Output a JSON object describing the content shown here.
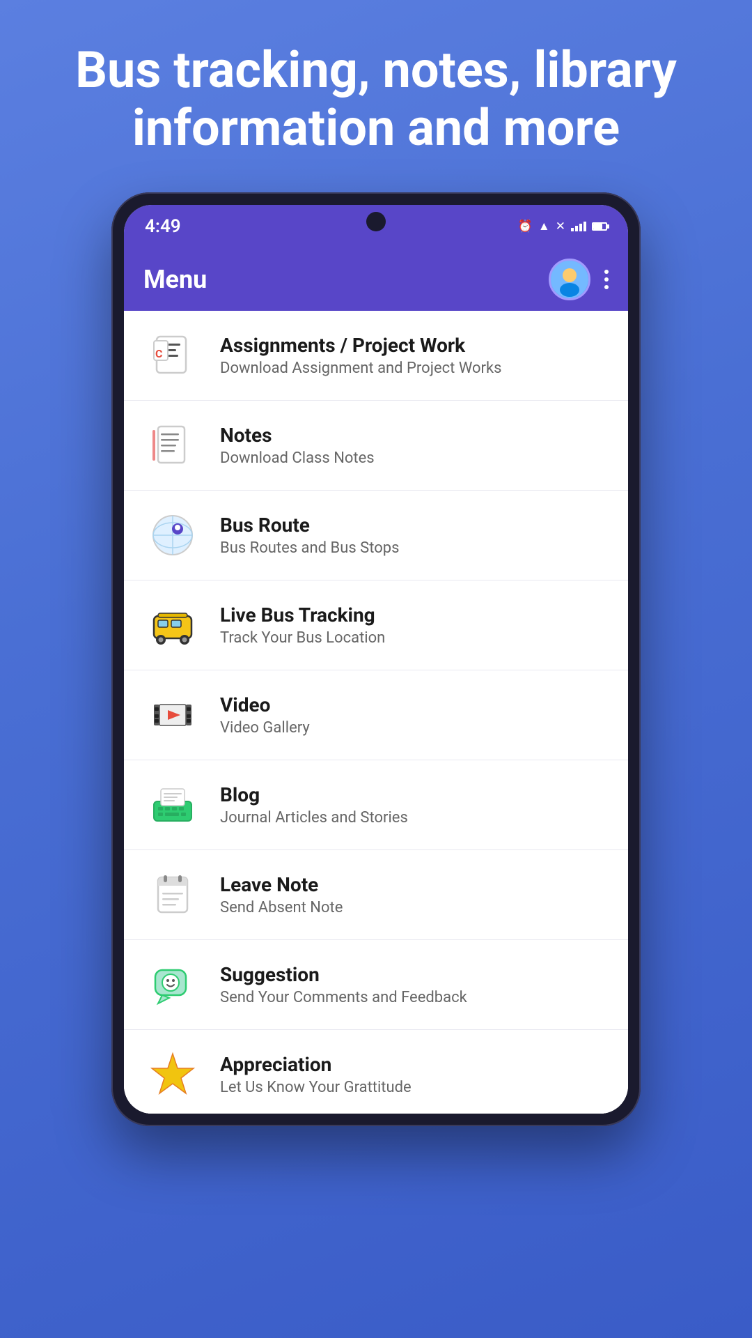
{
  "hero": {
    "text": "Bus tracking, notes, library information and more"
  },
  "status_bar": {
    "time": "4:49",
    "bg_color": "#5846c8"
  },
  "app_bar": {
    "title": "Menu",
    "bg_color": "#5846c8"
  },
  "menu_items": [
    {
      "id": "assignments",
      "title": "Assignments / Project Work",
      "subtitle": "Download Assignment and Project Works",
      "icon_type": "assignments"
    },
    {
      "id": "notes",
      "title": "Notes",
      "subtitle": "Download Class Notes",
      "icon_type": "notes"
    },
    {
      "id": "bus-route",
      "title": "Bus Route",
      "subtitle": "Bus Routes and Bus Stops",
      "icon_type": "bus-route"
    },
    {
      "id": "live-bus",
      "title": "Live Bus Tracking",
      "subtitle": "Track Your Bus Location",
      "icon_type": "live-bus"
    },
    {
      "id": "video",
      "title": "Video",
      "subtitle": "Video Gallery",
      "icon_type": "video"
    },
    {
      "id": "blog",
      "title": "Blog",
      "subtitle": "Journal Articles and Stories",
      "icon_type": "blog"
    },
    {
      "id": "leave-note",
      "title": "Leave Note",
      "subtitle": "Send Absent Note",
      "icon_type": "leave-note"
    },
    {
      "id": "suggestion",
      "title": "Suggestion",
      "subtitle": "Send Your Comments and Feedback",
      "icon_type": "suggestion"
    },
    {
      "id": "appreciation",
      "title": "Appreciation",
      "subtitle": "Let Us Know Your Grattitude",
      "icon_type": "appreciation"
    }
  ]
}
